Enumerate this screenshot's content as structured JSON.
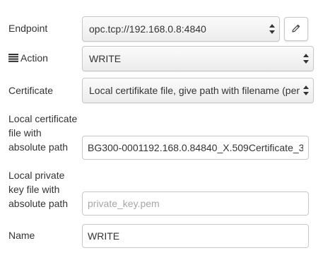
{
  "endpoint": {
    "label": "Endpoint",
    "value": "opc.tcp://192.168.0.8:4840",
    "edit_icon": "pencil-icon"
  },
  "action": {
    "icon": "list-icon",
    "label": "Action",
    "value": "WRITE"
  },
  "certificate": {
    "label": "Certificate",
    "value": "Local certifikate file, give path with filename (per"
  },
  "local_cert": {
    "label_lines": [
      "Local certificate",
      "file with",
      "absolute path"
    ],
    "value": "BG300-0001192.168.0.84840_X.509Certificate_3"
  },
  "local_key": {
    "label_lines": [
      "Local private",
      "key file with",
      "absolute path"
    ],
    "value": "",
    "placeholder": "private_key.pem"
  },
  "name": {
    "label": "Name",
    "value": "WRITE"
  }
}
